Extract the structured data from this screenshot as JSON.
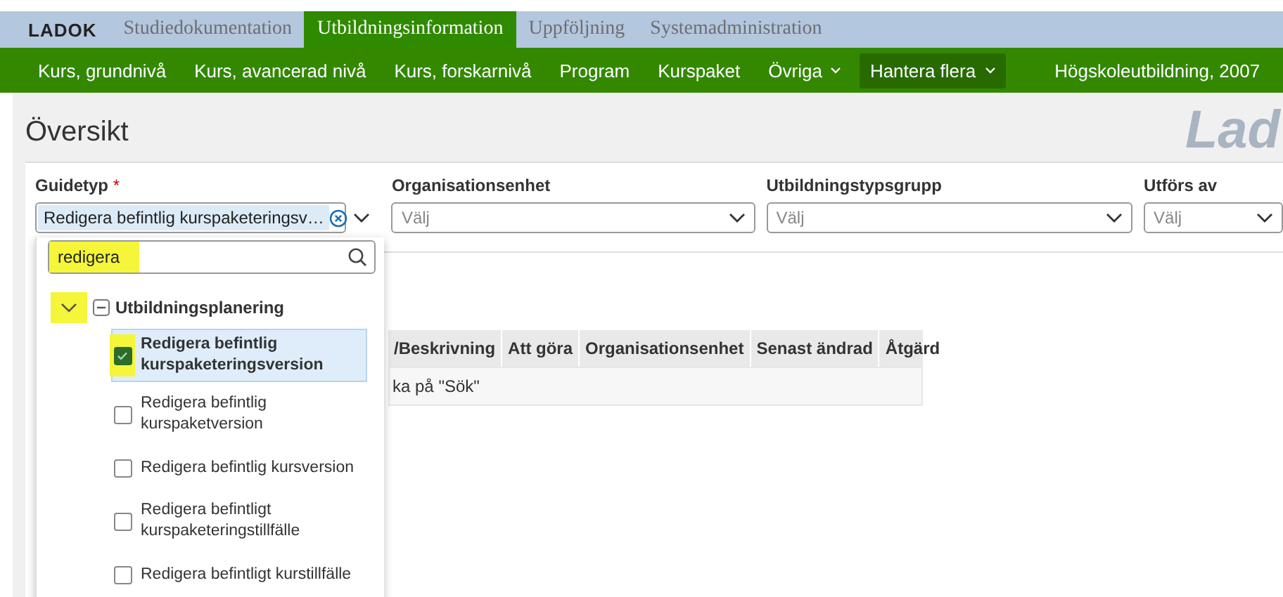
{
  "app_tabs": {
    "logo": "LADOK",
    "items": [
      {
        "label": "Studiedokumentation",
        "selected": false
      },
      {
        "label": "Utbildningsinformation",
        "selected": true
      },
      {
        "label": "Uppföljning",
        "selected": false
      },
      {
        "label": "Systemadministration",
        "selected": false
      }
    ]
  },
  "nav": {
    "items": [
      {
        "label": "Kurs, grundnivå",
        "dropdown": false,
        "selected": false
      },
      {
        "label": "Kurs, avancerad nivå",
        "dropdown": false,
        "selected": false
      },
      {
        "label": "Kurs, forskarnivå",
        "dropdown": false,
        "selected": false
      },
      {
        "label": "Program",
        "dropdown": false,
        "selected": false
      },
      {
        "label": "Kurspaket",
        "dropdown": false,
        "selected": false
      },
      {
        "label": "Övriga",
        "dropdown": true,
        "selected": false
      },
      {
        "label": "Hantera flera",
        "dropdown": true,
        "selected": true
      }
    ],
    "context": "Högskoleutbildning, 2007"
  },
  "page": {
    "title": "Översikt",
    "logo": "Lad"
  },
  "filters": [
    {
      "label": "Guidetyp",
      "required_mark": "*",
      "value": "Redigera befintlig kurspaketeringsv…",
      "clearable": true,
      "expanded": true
    },
    {
      "label": "Organisationsenhet",
      "placeholder": "Välj",
      "expanded": false
    },
    {
      "label": "Utbildningstypsgrupp",
      "placeholder": "Välj",
      "expanded": false
    },
    {
      "label": "Utförs av",
      "placeholder": "Välj",
      "expanded": false
    }
  ],
  "dropdown": {
    "search": {
      "value": "redigera",
      "highlighted": true
    },
    "group": {
      "label": "Utbildningsplanering",
      "expanded": true,
      "highlighted": true,
      "children": [
        {
          "label": "Redigera befintlig kurspaketeringsversion",
          "checked": true,
          "selected": true,
          "highlighted": true
        },
        {
          "label": "Redigera befintlig kurspaketversion",
          "checked": false,
          "selected": false,
          "highlighted": false
        },
        {
          "label": "Redigera befintlig kursversion",
          "checked": false,
          "selected": false,
          "highlighted": false
        },
        {
          "label": "Redigera befintligt kurspaketeringstillfälle",
          "checked": false,
          "selected": false,
          "highlighted": false
        },
        {
          "label": "Redigera befintligt kurstillfälle",
          "checked": false,
          "selected": false,
          "highlighted": false
        }
      ]
    }
  },
  "table": {
    "columns": [
      "/Beskrivning",
      "Att göra",
      "Organisationsenhet",
      "Senast ändrad",
      "Åtgärd"
    ],
    "empty_message": "ka på \"Sök\""
  }
}
